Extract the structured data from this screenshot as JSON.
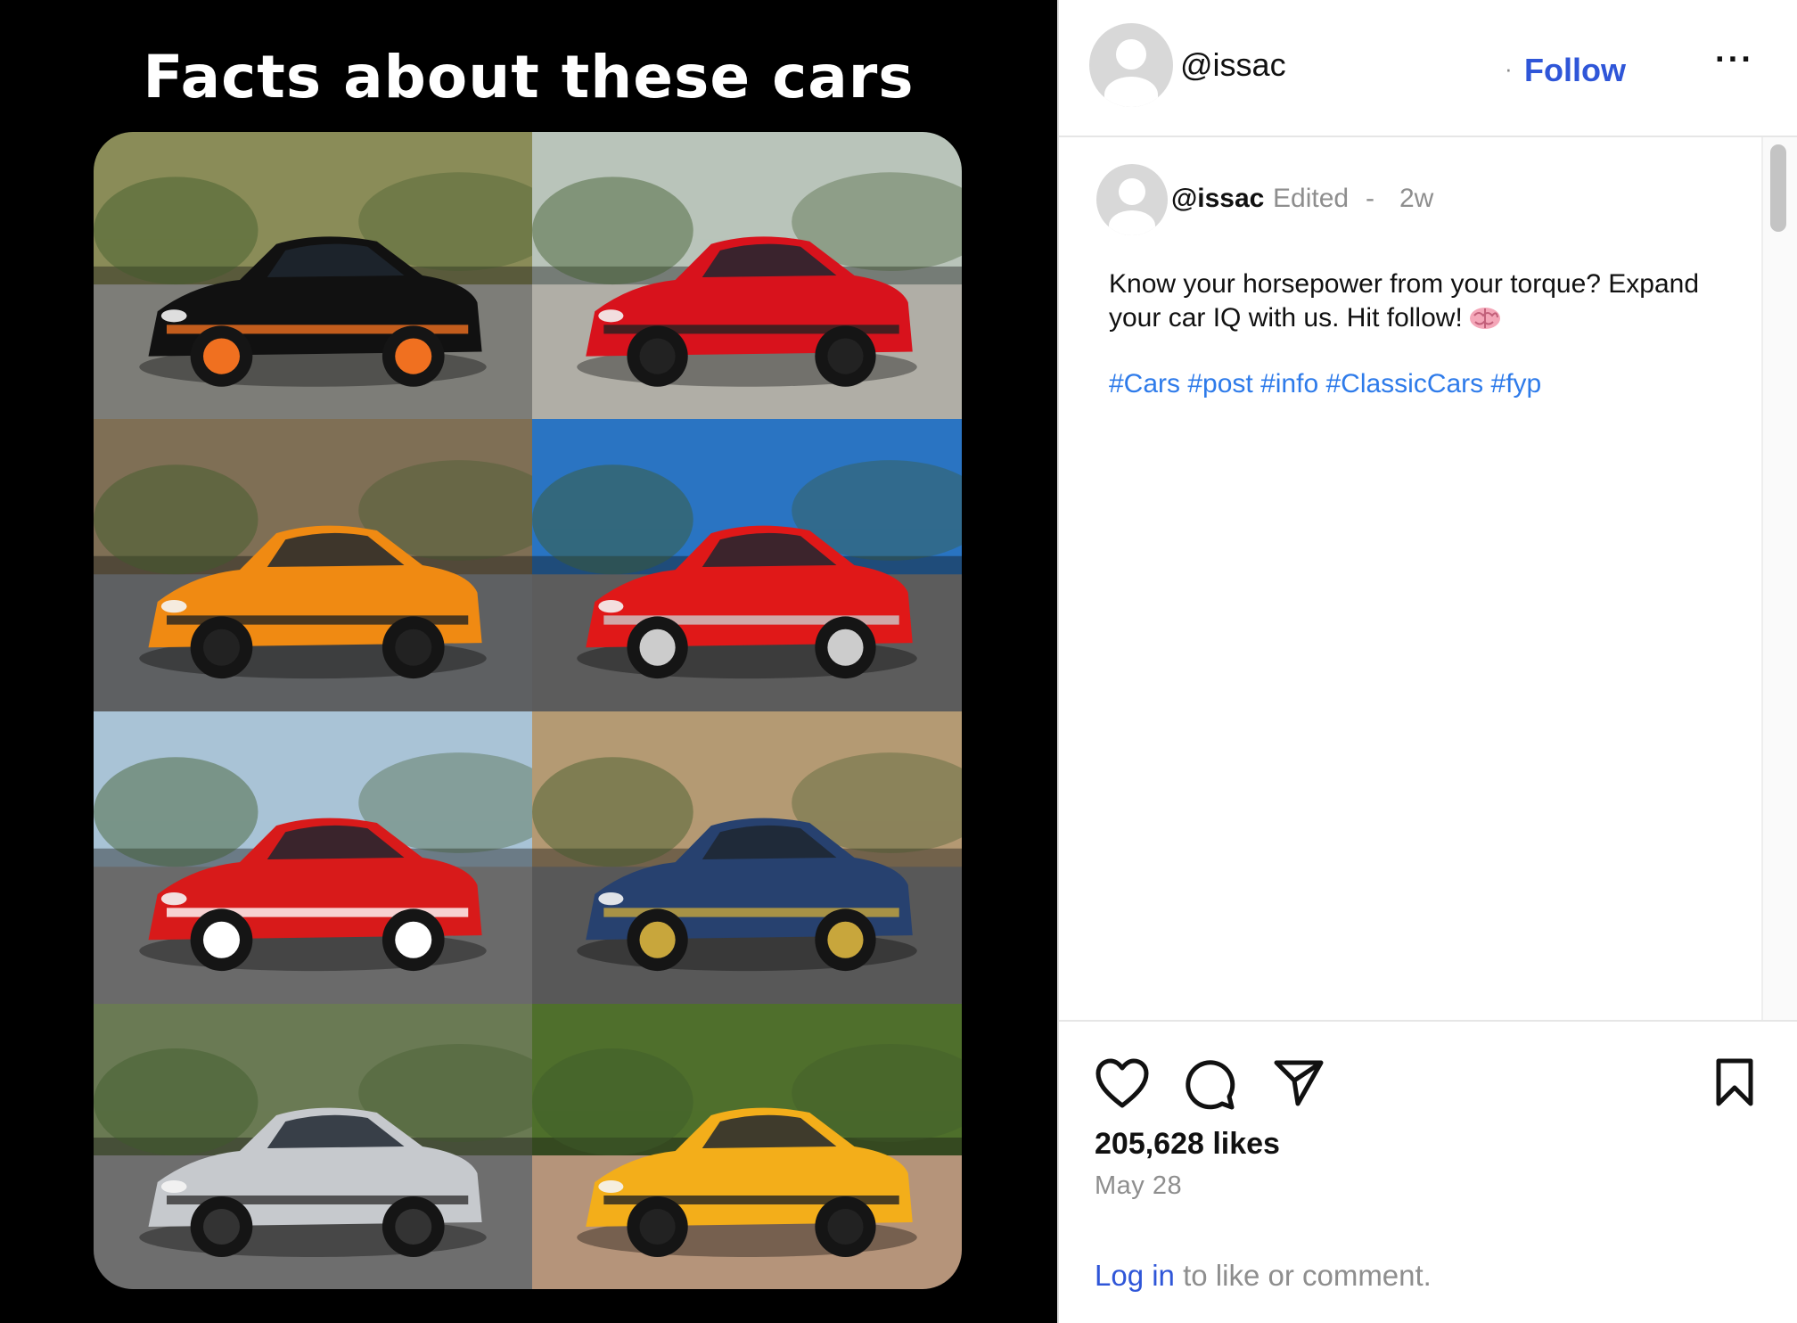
{
  "media": {
    "title": "Facts about these cars",
    "tiles": [
      {
        "name": "tile-black-porsche",
        "body_color": "#111111",
        "accent": "#f07020",
        "sky": "#8a8c58",
        "ground": "#7d7d78"
      },
      {
        "name": "tile-red-mercedes",
        "body_color": "#d8121c",
        "accent": "#222222",
        "sky": "#b9c4ba",
        "ground": "#b0aea6"
      },
      {
        "name": "tile-orange-lamborghini",
        "body_color": "#f08a12",
        "accent": "#222222",
        "sky": "#7f6f55",
        "ground": "#5e6062"
      },
      {
        "name": "tile-red-bmw",
        "body_color": "#e01818",
        "accent": "#cccccc",
        "sky": "#2a74c2",
        "ground": "#5c5c5c"
      },
      {
        "name": "tile-red-ferrari",
        "body_color": "#d81a1a",
        "accent": "#ffffff",
        "sky": "#a9c3d6",
        "ground": "#6a6a6a"
      },
      {
        "name": "tile-blue-pagani",
        "body_color": "#27416f",
        "accent": "#c8a63c",
        "sky": "#b49a73",
        "ground": "#585858"
      },
      {
        "name": "tile-silver-audi",
        "body_color": "#c6c9cd",
        "accent": "#333333",
        "sky": "#6a7a54",
        "ground": "#6e6e6e"
      },
      {
        "name": "tile-yellow-lexus",
        "body_color": "#f3ae1a",
        "accent": "#222222",
        "sky": "#4f6f2c",
        "ground": "#b5947a"
      }
    ]
  },
  "header": {
    "username": "@issac",
    "follow_label": "Follow",
    "separator": "·",
    "more_label": "···"
  },
  "comment": {
    "username": "@issac",
    "edited_label": "Edited",
    "separator": "-",
    "time": "2w",
    "caption": "Know your horsepower from your torque? Expand your car IQ with us. Hit follow!",
    "emoji_icon": "brain-emoji",
    "hashtags": "#Cars #post #info #ClassicCars #fyp"
  },
  "actions": {
    "likes": "205,628 likes",
    "date": "May 28",
    "login_link": "Log in",
    "login_rest": " to like or comment."
  },
  "colors": {
    "link_blue": "#2f56d8",
    "hashtag_blue": "#2e7bea",
    "muted_gray": "#8e8e8e"
  }
}
